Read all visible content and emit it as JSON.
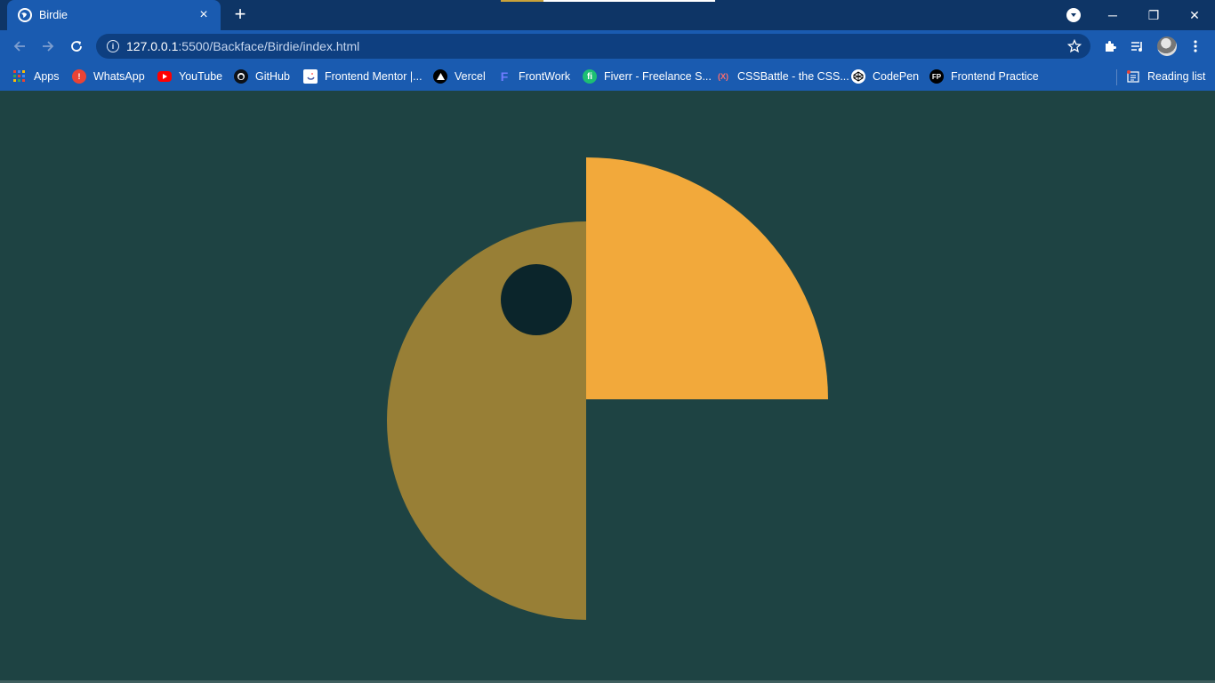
{
  "browser": {
    "tab": {
      "title": "Birdie",
      "close": "×"
    },
    "new_tab": "+",
    "window": {
      "minimize": "─",
      "restore": "❐",
      "close": "✕"
    },
    "address": {
      "host": "127.0.0.1",
      "path": ":5500/Backface/Birdie/index.html"
    }
  },
  "bookmarks": [
    {
      "label": "Apps",
      "icon": "apps-grid-icon",
      "color": "#ea4335"
    },
    {
      "label": "WhatsApp",
      "icon": "whatsapp-icon",
      "color": "#ea4335"
    },
    {
      "label": "YouTube",
      "icon": "youtube-icon",
      "color": "#ff0000"
    },
    {
      "label": "GitHub",
      "icon": "github-icon",
      "color": "#0d1117"
    },
    {
      "label": "Frontend Mentor |...",
      "icon": "frontend-mentor-icon",
      "color": "#ffffff"
    },
    {
      "label": "Vercel",
      "icon": "vercel-icon",
      "color": "#000000"
    },
    {
      "label": "FrontWork",
      "icon": "frontwork-icon",
      "color": "#6f7cff"
    },
    {
      "label": "Fiverr - Freelance S...",
      "icon": "fiverr-icon",
      "color": "#1dbf73"
    },
    {
      "label": "CSSBattle - the CSS...",
      "icon": "cssbattle-icon",
      "color": "#ff6d6d"
    },
    {
      "label": "CodePen",
      "icon": "codepen-icon",
      "color": "#ffffff"
    },
    {
      "label": "Frontend Practice",
      "icon": "frontend-practice-icon",
      "color": "#000000",
      "badge": "FP"
    }
  ],
  "reading_list": {
    "label": "Reading list",
    "icon": "reading-list-icon"
  },
  "page": {
    "background": "#1e4343",
    "shapes": {
      "body_color": "#987f36",
      "beak_color": "#f2a93b",
      "eye_color": "#0b252b"
    }
  }
}
